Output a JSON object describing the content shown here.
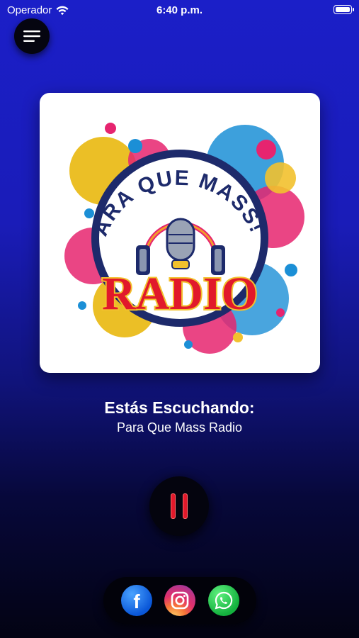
{
  "status_bar": {
    "carrier": "Operador",
    "time": "6:40 p.m.",
    "icons": [
      "wifi-icon",
      "battery-icon"
    ]
  },
  "menu": {
    "icon": "hamburger-menu-icon"
  },
  "artwork": {
    "logo_arc_text": "PARA QUE MASS!!!",
    "logo_main_text": "RADIO",
    "logo_colors": [
      "#e6246f",
      "#f2c12e",
      "#1b8fd6",
      "#e8b400",
      "#1d2a6b"
    ]
  },
  "player": {
    "now_playing_label": "Estás Escuchando:",
    "station_name": "Para Que Mass Radio",
    "state_icon": "pause-icon",
    "accent_color": "#e1192b"
  },
  "social": [
    {
      "name": "Facebook",
      "icon": "facebook-icon"
    },
    {
      "name": "Instagram",
      "icon": "instagram-icon"
    },
    {
      "name": "WhatsApp",
      "icon": "whatsapp-icon"
    }
  ]
}
